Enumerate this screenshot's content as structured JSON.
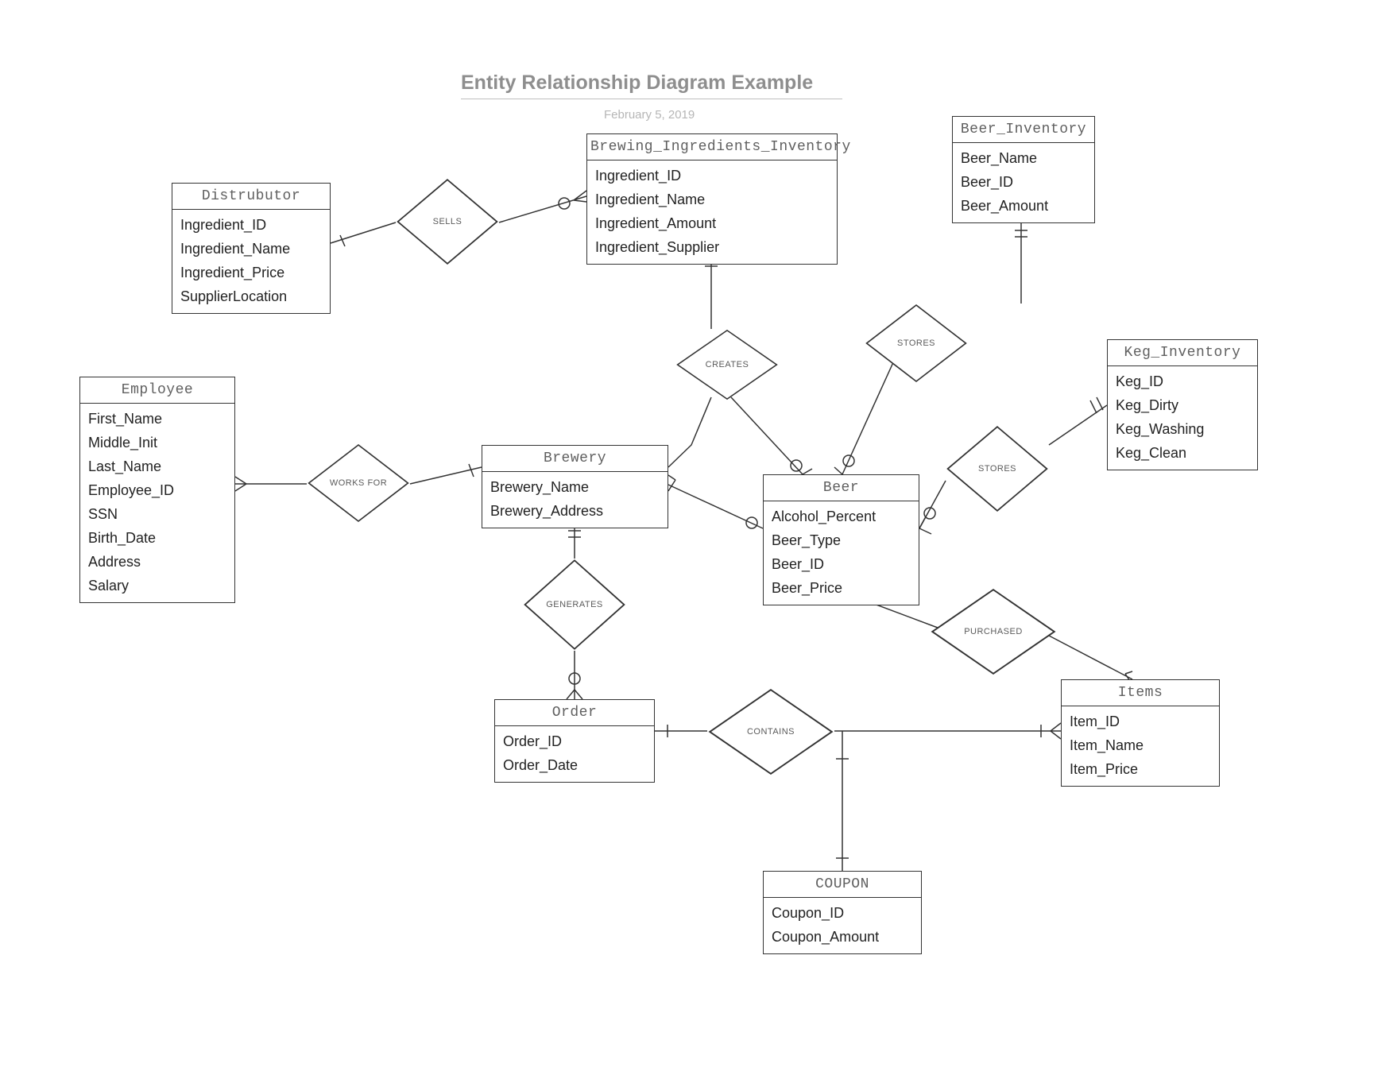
{
  "title": "Entity Relationship Diagram Example",
  "date": "February 5, 2019",
  "entities": {
    "distributor": {
      "name": "Distrubutor",
      "attrs": [
        "Ingredient_ID",
        "Ingredient_Name",
        "Ingredient_Price",
        "SupplierLocation"
      ]
    },
    "brewing_ingredients": {
      "name": "Brewing_Ingredients_Inventory",
      "attrs": [
        "Ingredient_ID",
        "Ingredient_Name",
        "Ingredient_Amount",
        "Ingredient_Supplier"
      ]
    },
    "beer_inventory": {
      "name": "Beer_Inventory",
      "attrs": [
        "Beer_Name",
        "Beer_ID",
        "Beer_Amount"
      ]
    },
    "employee": {
      "name": "Employee",
      "attrs": [
        "First_Name",
        "Middle_Init",
        "Last_Name",
        "Employee_ID",
        "SSN",
        "Birth_Date",
        "Address",
        "Salary"
      ]
    },
    "brewery": {
      "name": "Brewery",
      "attrs": [
        "Brewery_Name",
        "Brewery_Address"
      ]
    },
    "keg_inventory": {
      "name": "Keg_Inventory",
      "attrs": [
        "Keg_ID",
        "Keg_Dirty",
        "Keg_Washing",
        "Keg_Clean"
      ]
    },
    "beer": {
      "name": "Beer",
      "attrs": [
        "Alcohol_Percent",
        "Beer_Type",
        "Beer_ID",
        "Beer_Price"
      ]
    },
    "order": {
      "name": "Order",
      "attrs": [
        "Order_ID",
        "Order_Date"
      ]
    },
    "items": {
      "name": "Items",
      "attrs": [
        "Item_ID",
        "Item_Name",
        "Item_Price"
      ]
    },
    "coupon": {
      "name": "COUPON",
      "attrs": [
        "Coupon_ID",
        "Coupon_Amount"
      ]
    }
  },
  "relationships": {
    "sells": "SELLS",
    "works_for": "WORKS FOR",
    "creates": "CREATES",
    "stores1": "STORES",
    "stores2": "STORES",
    "generates": "GENERATES",
    "purchased": "PURCHASED",
    "contains": "CONTAINS"
  }
}
